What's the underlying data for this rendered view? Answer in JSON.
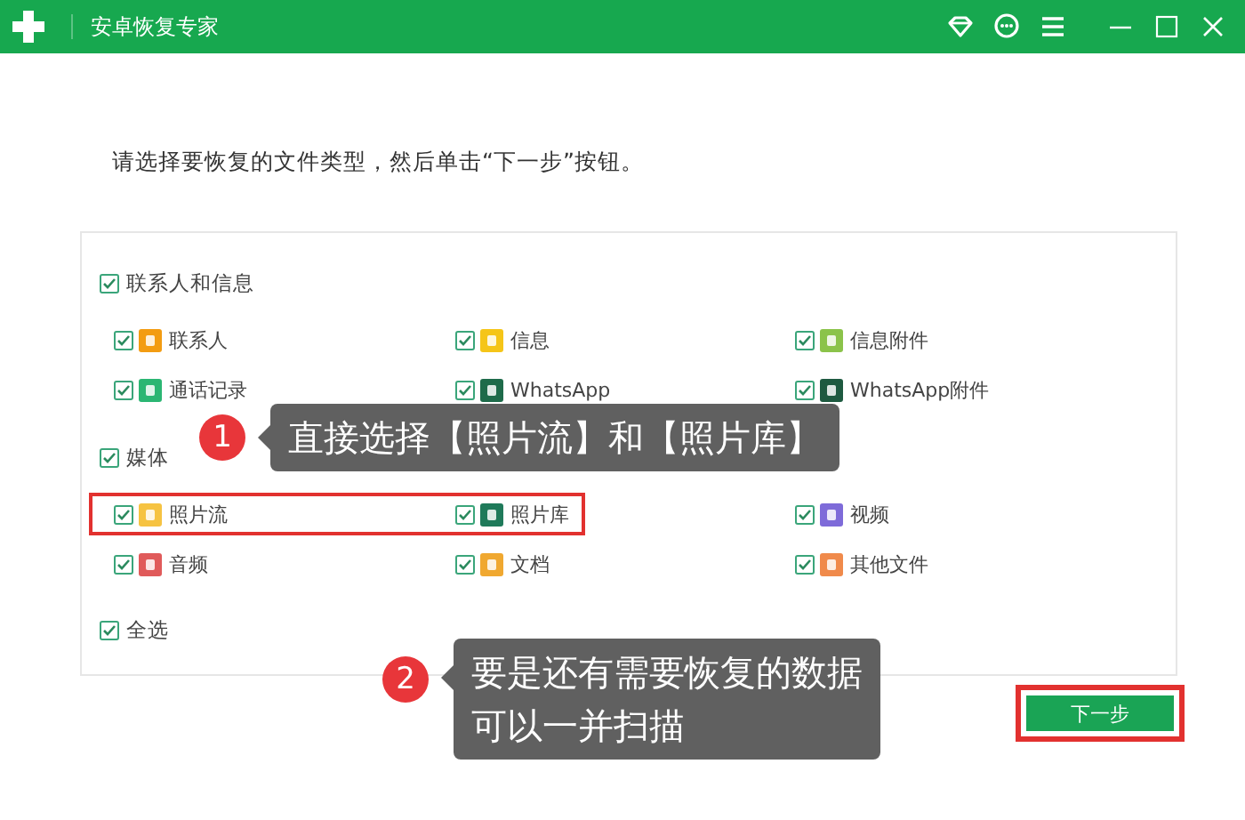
{
  "window": {
    "title": "安卓恢复专家"
  },
  "instruction": "请选择要恢复的文件类型，然后单击“下一步”按钮。",
  "groups": [
    {
      "label": "联系人和信息",
      "checked": true,
      "items": [
        {
          "label": "联系人",
          "checked": true,
          "color": "#f39c12"
        },
        {
          "label": "信息",
          "checked": true,
          "color": "#f5c518"
        },
        {
          "label": "信息附件",
          "checked": true,
          "color": "#8bc34a"
        },
        {
          "label": "通话记录",
          "checked": true,
          "color": "#2bb673"
        },
        {
          "label": "WhatsApp",
          "checked": true,
          "color": "#1e6b4a"
        },
        {
          "label": "WhatsApp附件",
          "checked": true,
          "color": "#1e5a40"
        }
      ]
    },
    {
      "label": "媒体",
      "checked": true,
      "items": [
        {
          "label": "照片流",
          "checked": true,
          "color": "#f6c342"
        },
        {
          "label": "照片库",
          "checked": true,
          "color": "#1f7a5a"
        },
        {
          "label": "视频",
          "checked": true,
          "color": "#7e6bd9"
        },
        {
          "label": "音频",
          "checked": true,
          "color": "#e05a5a"
        },
        {
          "label": "文档",
          "checked": true,
          "color": "#f0a830"
        },
        {
          "label": "其他文件",
          "checked": true,
          "color": "#f08a4b"
        }
      ]
    }
  ],
  "select_all": {
    "label": "全选",
    "checked": true
  },
  "next_button": "下一步",
  "callouts": [
    {
      "number": "1",
      "lines": [
        "直接选择【照片流】和【照片库】"
      ]
    },
    {
      "number": "2",
      "lines": [
        "要是还有需要恢复的数据",
        "可以一并扫描"
      ]
    }
  ]
}
